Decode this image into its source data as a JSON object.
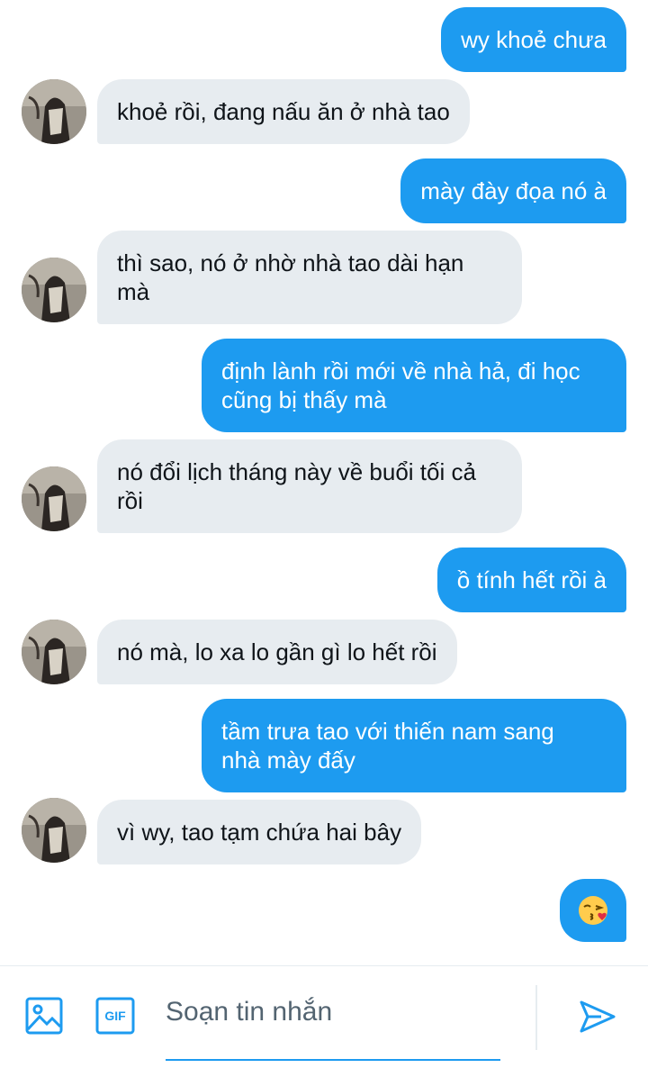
{
  "messages": [
    {
      "dir": "out",
      "text": "wy khoẻ chưa"
    },
    {
      "dir": "in",
      "text": "khoẻ rồi, đang nấu ăn ở nhà tao"
    },
    {
      "dir": "out",
      "text": "mày đày đọa nó à"
    },
    {
      "dir": "in",
      "text": "thì sao, nó ở nhờ nhà tao dài hạn\nmà"
    },
    {
      "dir": "out",
      "text": "định lành rồi mới về nhà hả, đi học\ncũng bị thấy mà"
    },
    {
      "dir": "in",
      "text": "nó đổi lịch tháng này về buổi tối cả\nrồi"
    },
    {
      "dir": "out",
      "text": "ồ tính hết rồi à"
    },
    {
      "dir": "in",
      "text": "nó mà, lo xa lo gần gì lo hết rồi"
    },
    {
      "dir": "out",
      "text": "tầm trưa tao với thiến nam sang\nnhà mày đấy"
    },
    {
      "dir": "in",
      "text": "vì wy, tao tạm chứa hai bây"
    },
    {
      "dir": "out",
      "emoji": "face-blowing-a-kiss"
    }
  ],
  "composer": {
    "placeholder": "Soạn tin nhắn",
    "gif_label": "GIF",
    "icons": [
      "image-icon",
      "gif-icon",
      "send-icon"
    ]
  },
  "colors": {
    "accent": "#1d9bf0",
    "incoming_bubble": "#e7ecf0",
    "text": "#0f1419",
    "placeholder": "#536471"
  }
}
